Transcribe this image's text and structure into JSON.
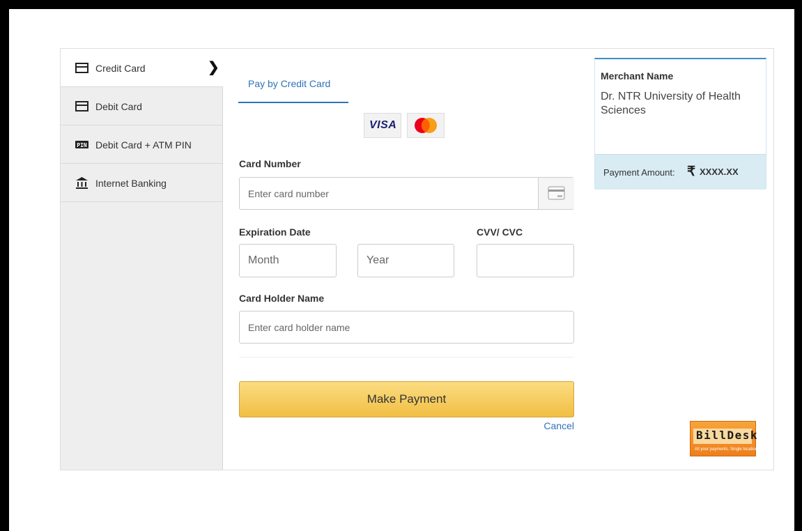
{
  "sidebar": {
    "items": [
      {
        "label": "Credit Card",
        "icon": "card-icon",
        "active": true
      },
      {
        "label": "Debit Card",
        "icon": "card-icon",
        "active": false
      },
      {
        "label": "Debit Card + ATM PIN",
        "icon": "pin-icon",
        "active": false
      },
      {
        "label": "Internet Banking",
        "icon": "bank-icon",
        "active": false
      }
    ]
  },
  "tab": {
    "label": "Pay by Credit Card"
  },
  "brands": {
    "visa": "VISA",
    "mastercard": "mastercard-logo"
  },
  "form": {
    "card_number_label": "Card Number",
    "card_number_placeholder": "Enter card number",
    "expiration_label": "Expiration Date",
    "month_placeholder": "Month",
    "year_placeholder": "Year",
    "cvv_label": "CVV/ CVC",
    "cvv_placeholder": "",
    "holder_label": "Card Holder Name",
    "holder_placeholder": "Enter card holder name"
  },
  "actions": {
    "pay_label": "Make Payment",
    "cancel_label": "Cancel"
  },
  "merchant": {
    "label": "Merchant Name",
    "name": "Dr. NTR University of Health Sciences",
    "amount_label": "Payment Amount:",
    "currency_symbol": "₹",
    "amount": "XXXX.XX"
  },
  "billdesk": {
    "name": "BillDesk",
    "tagline": "All your payments. Single location."
  },
  "colors": {
    "accent": "#2f73b8",
    "button": "#f1bf43",
    "sidebar": "#eeeeee",
    "amount_bg": "#d9ecf4"
  }
}
